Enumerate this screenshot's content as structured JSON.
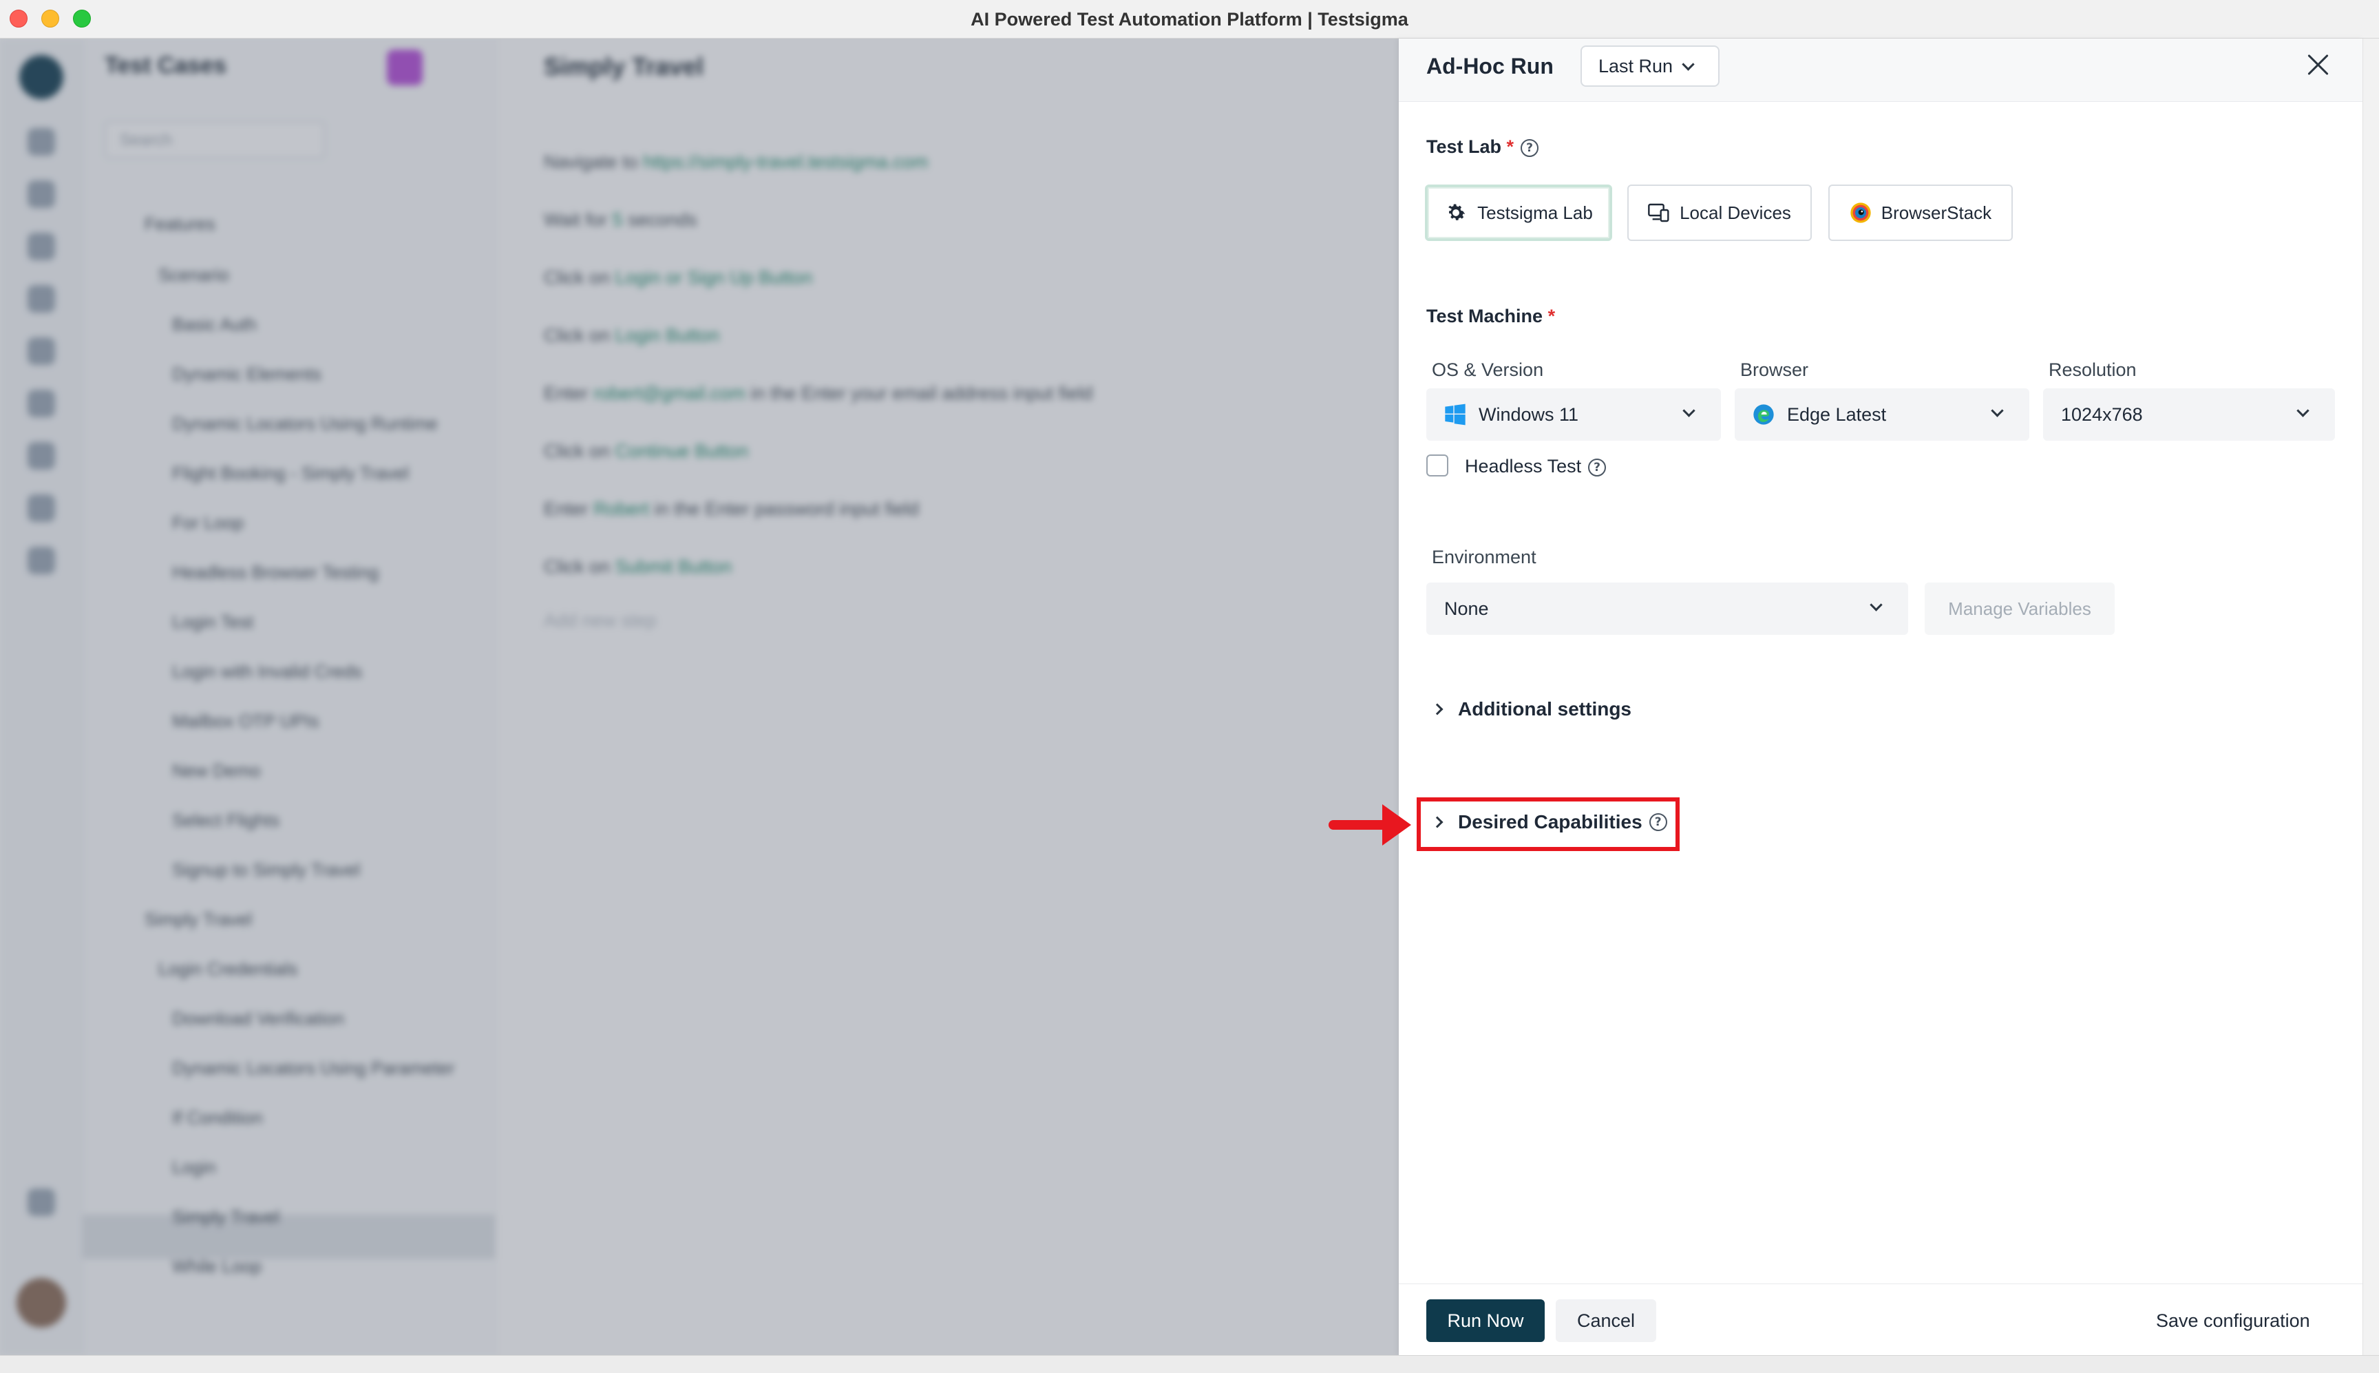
{
  "window": {
    "title": "AI Powered Test Automation Platform | Testsigma"
  },
  "background": {
    "tree_title": "Test Cases",
    "search_placeholder": "Search",
    "tree_items": [
      "Features",
      "Scenario",
      "Basic Auth",
      "Dynamic Elements",
      "Dynamic Locators Using Runtime",
      "Flight Booking - Simply Travel",
      "For Loop",
      "Headless Browser Testing",
      "Login Test",
      "Login with Invalid Creds",
      "Mailbox OTP UPIs",
      "New Demo",
      "Select Flights",
      "Signup to Simply Travel",
      "Simply Travel",
      "Login Credentials",
      "Download Verification",
      "Dynamic Locators Using Parameter",
      "If Condition",
      "Login",
      "Simply Travel",
      "While Loop"
    ],
    "editor_title": "Simply Travel",
    "steps": [
      {
        "prefix": "Navigate to",
        "hl": "https://simply-travel.testsigma.com",
        "suffix": ""
      },
      {
        "prefix": "Wait for",
        "hl": "5",
        "suffix": "seconds"
      },
      {
        "prefix": "Click on",
        "hl": "Login or Sign Up Button",
        "suffix": ""
      },
      {
        "prefix": "Click on",
        "hl": "Login Button",
        "suffix": ""
      },
      {
        "prefix": "Enter",
        "hl": "robert@gmail.com",
        "suffix": "in the Enter your email address input field"
      },
      {
        "prefix": "Click on",
        "hl": "Continue Button",
        "suffix": ""
      },
      {
        "prefix": "Enter",
        "hl": "Robert",
        "suffix": "in the Enter password input field"
      },
      {
        "prefix": "Click on",
        "hl": "Submit Button",
        "suffix": ""
      },
      {
        "prefix": "Add new step",
        "hl": "",
        "suffix": ""
      }
    ]
  },
  "drawer": {
    "title": "Ad-Hoc Run",
    "run_select": "Last Run",
    "test_lab": {
      "label": "Test Lab",
      "required": "*",
      "options": [
        "Testsigma Lab",
        "Local Devices",
        "BrowserStack"
      ],
      "selected": "Testsigma Lab"
    },
    "test_machine": {
      "label": "Test Machine",
      "required": "*",
      "os_label": "OS & Version",
      "os_value": "Windows 11",
      "browser_label": "Browser",
      "browser_value": "Edge Latest",
      "resolution_label": "Resolution",
      "resolution_value": "1024x768",
      "headless_label": "Headless Test",
      "headless_checked": false
    },
    "environment": {
      "label": "Environment",
      "value": "None",
      "manage_label": "Manage Variables"
    },
    "additional_settings": "Additional settings",
    "desired_capabilities": "Desired Capabilities",
    "footer": {
      "run_now": "Run Now",
      "cancel": "Cancel",
      "save_config": "Save configuration"
    }
  },
  "colors": {
    "primary_button": "#0f3a4c",
    "highlight_annotation": "#e8171f",
    "required_mark": "#e03131",
    "link_green": "#1b8a6a"
  }
}
